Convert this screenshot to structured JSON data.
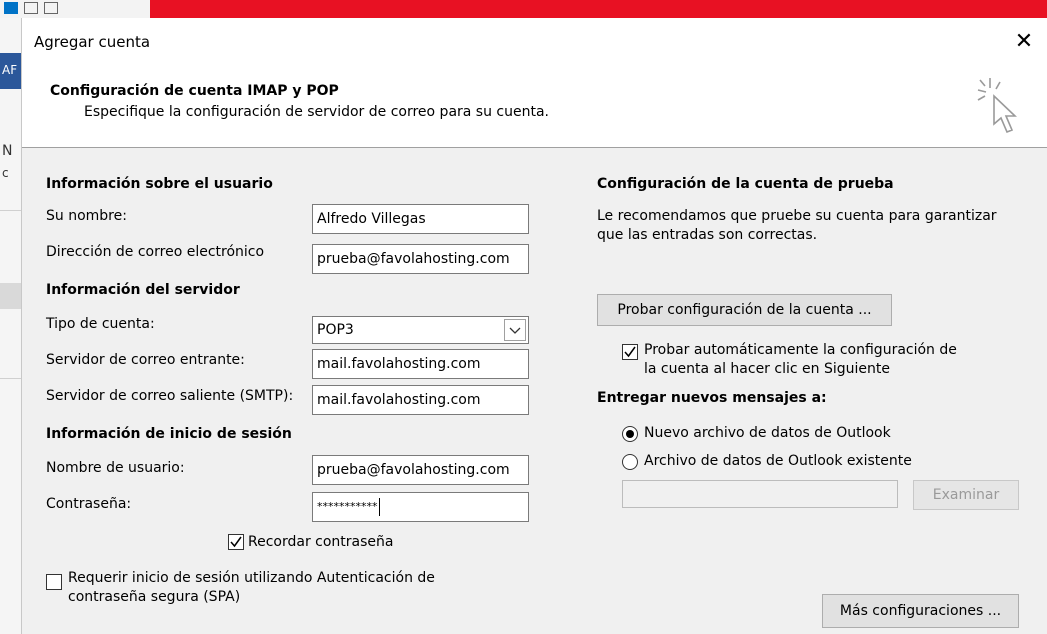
{
  "background_window": {
    "left_n": "N",
    "left_c": "c",
    "left_blue": "AF"
  },
  "dialog": {
    "title": "Agregar cuenta",
    "close_glyph": "✕",
    "header_title": "Configuración de cuenta IMAP y POP",
    "header_subtitle": "Especifique la configuración de servidor de correo para su cuenta."
  },
  "user_info": {
    "section_title": "Información sobre el usuario",
    "name_label": "Su nombre:",
    "name_value": "Alfredo Villegas",
    "email_label": "Dirección de correo electrónico",
    "email_value": "prueba@favolahosting.com"
  },
  "server_info": {
    "section_title": "Información del servidor",
    "account_type_label": "Tipo de cuenta:",
    "account_type_value": "POP3",
    "incoming_label": "Servidor de correo entrante:",
    "incoming_value": "mail.favolahosting.com",
    "outgoing_label": "Servidor de correo saliente (SMTP):",
    "outgoing_value": "mail.favolahosting.com"
  },
  "login_info": {
    "section_title": "Información de inicio de sesión",
    "username_label": "Nombre de usuario:",
    "username_value": "prueba@favolahosting.com",
    "password_label": "Contraseña:",
    "password_value": "***********",
    "remember_label": "Recordar contraseña",
    "remember_checked": true,
    "spa_label_line1": "Requerir inicio de sesión utilizando Autenticación de",
    "spa_label_line2": "contraseña segura (SPA)",
    "spa_checked": false
  },
  "test_settings": {
    "section_title": "Configuración de la cuenta de prueba",
    "description_line1": "Le recomendamos que pruebe su cuenta para garantizar",
    "description_line2": "que las entradas son correctas.",
    "test_button": "Probar configuración de la cuenta ...",
    "auto_test_line1": "Probar automáticamente la configuración de",
    "auto_test_line2": "la cuenta al hacer clic en Siguiente",
    "auto_test_checked": true
  },
  "deliver": {
    "section_title": "Entregar nuevos mensajes a:",
    "option_new": "Nuevo archivo de datos de Outlook",
    "option_existing": "Archivo de datos de Outlook existente",
    "selected": "new",
    "path_value": "",
    "browse_button": "Examinar"
  },
  "more_settings_button": "Más configuraciones ...",
  "colors": {
    "body_bg": "#f0f0f0",
    "title_bar_red": "#e81123",
    "outlook_blue": "#0072c6"
  }
}
